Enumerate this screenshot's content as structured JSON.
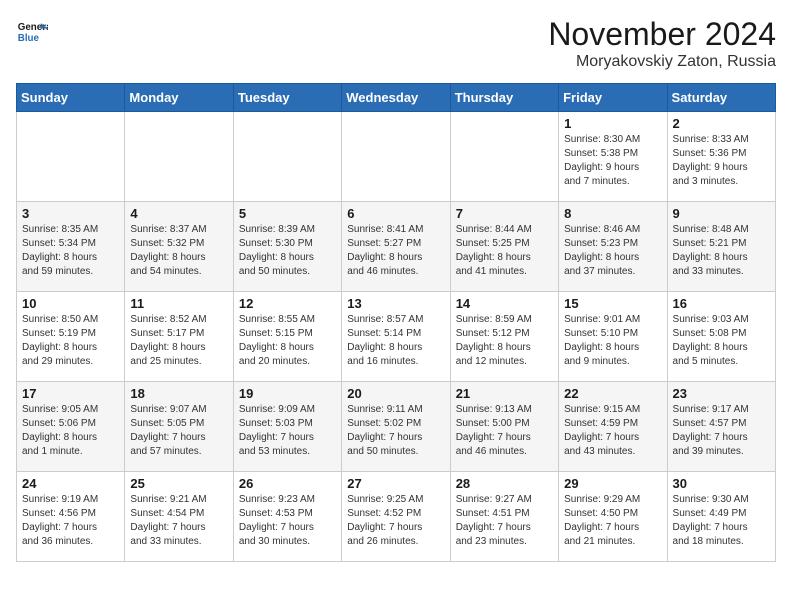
{
  "header": {
    "logo_line1": "General",
    "logo_line2": "Blue",
    "month": "November 2024",
    "location": "Moryakovskiy Zaton, Russia"
  },
  "days_of_week": [
    "Sunday",
    "Monday",
    "Tuesday",
    "Wednesday",
    "Thursday",
    "Friday",
    "Saturday"
  ],
  "weeks": [
    [
      {
        "day": "",
        "info": ""
      },
      {
        "day": "",
        "info": ""
      },
      {
        "day": "",
        "info": ""
      },
      {
        "day": "",
        "info": ""
      },
      {
        "day": "",
        "info": ""
      },
      {
        "day": "1",
        "info": "Sunrise: 8:30 AM\nSunset: 5:38 PM\nDaylight: 9 hours\nand 7 minutes."
      },
      {
        "day": "2",
        "info": "Sunrise: 8:33 AM\nSunset: 5:36 PM\nDaylight: 9 hours\nand 3 minutes."
      }
    ],
    [
      {
        "day": "3",
        "info": "Sunrise: 8:35 AM\nSunset: 5:34 PM\nDaylight: 8 hours\nand 59 minutes."
      },
      {
        "day": "4",
        "info": "Sunrise: 8:37 AM\nSunset: 5:32 PM\nDaylight: 8 hours\nand 54 minutes."
      },
      {
        "day": "5",
        "info": "Sunrise: 8:39 AM\nSunset: 5:30 PM\nDaylight: 8 hours\nand 50 minutes."
      },
      {
        "day": "6",
        "info": "Sunrise: 8:41 AM\nSunset: 5:27 PM\nDaylight: 8 hours\nand 46 minutes."
      },
      {
        "day": "7",
        "info": "Sunrise: 8:44 AM\nSunset: 5:25 PM\nDaylight: 8 hours\nand 41 minutes."
      },
      {
        "day": "8",
        "info": "Sunrise: 8:46 AM\nSunset: 5:23 PM\nDaylight: 8 hours\nand 37 minutes."
      },
      {
        "day": "9",
        "info": "Sunrise: 8:48 AM\nSunset: 5:21 PM\nDaylight: 8 hours\nand 33 minutes."
      }
    ],
    [
      {
        "day": "10",
        "info": "Sunrise: 8:50 AM\nSunset: 5:19 PM\nDaylight: 8 hours\nand 29 minutes."
      },
      {
        "day": "11",
        "info": "Sunrise: 8:52 AM\nSunset: 5:17 PM\nDaylight: 8 hours\nand 25 minutes."
      },
      {
        "day": "12",
        "info": "Sunrise: 8:55 AM\nSunset: 5:15 PM\nDaylight: 8 hours\nand 20 minutes."
      },
      {
        "day": "13",
        "info": "Sunrise: 8:57 AM\nSunset: 5:14 PM\nDaylight: 8 hours\nand 16 minutes."
      },
      {
        "day": "14",
        "info": "Sunrise: 8:59 AM\nSunset: 5:12 PM\nDaylight: 8 hours\nand 12 minutes."
      },
      {
        "day": "15",
        "info": "Sunrise: 9:01 AM\nSunset: 5:10 PM\nDaylight: 8 hours\nand 9 minutes."
      },
      {
        "day": "16",
        "info": "Sunrise: 9:03 AM\nSunset: 5:08 PM\nDaylight: 8 hours\nand 5 minutes."
      }
    ],
    [
      {
        "day": "17",
        "info": "Sunrise: 9:05 AM\nSunset: 5:06 PM\nDaylight: 8 hours\nand 1 minute."
      },
      {
        "day": "18",
        "info": "Sunrise: 9:07 AM\nSunset: 5:05 PM\nDaylight: 7 hours\nand 57 minutes."
      },
      {
        "day": "19",
        "info": "Sunrise: 9:09 AM\nSunset: 5:03 PM\nDaylight: 7 hours\nand 53 minutes."
      },
      {
        "day": "20",
        "info": "Sunrise: 9:11 AM\nSunset: 5:02 PM\nDaylight: 7 hours\nand 50 minutes."
      },
      {
        "day": "21",
        "info": "Sunrise: 9:13 AM\nSunset: 5:00 PM\nDaylight: 7 hours\nand 46 minutes."
      },
      {
        "day": "22",
        "info": "Sunrise: 9:15 AM\nSunset: 4:59 PM\nDaylight: 7 hours\nand 43 minutes."
      },
      {
        "day": "23",
        "info": "Sunrise: 9:17 AM\nSunset: 4:57 PM\nDaylight: 7 hours\nand 39 minutes."
      }
    ],
    [
      {
        "day": "24",
        "info": "Sunrise: 9:19 AM\nSunset: 4:56 PM\nDaylight: 7 hours\nand 36 minutes."
      },
      {
        "day": "25",
        "info": "Sunrise: 9:21 AM\nSunset: 4:54 PM\nDaylight: 7 hours\nand 33 minutes."
      },
      {
        "day": "26",
        "info": "Sunrise: 9:23 AM\nSunset: 4:53 PM\nDaylight: 7 hours\nand 30 minutes."
      },
      {
        "day": "27",
        "info": "Sunrise: 9:25 AM\nSunset: 4:52 PM\nDaylight: 7 hours\nand 26 minutes."
      },
      {
        "day": "28",
        "info": "Sunrise: 9:27 AM\nSunset: 4:51 PM\nDaylight: 7 hours\nand 23 minutes."
      },
      {
        "day": "29",
        "info": "Sunrise: 9:29 AM\nSunset: 4:50 PM\nDaylight: 7 hours\nand 21 minutes."
      },
      {
        "day": "30",
        "info": "Sunrise: 9:30 AM\nSunset: 4:49 PM\nDaylight: 7 hours\nand 18 minutes."
      }
    ]
  ]
}
